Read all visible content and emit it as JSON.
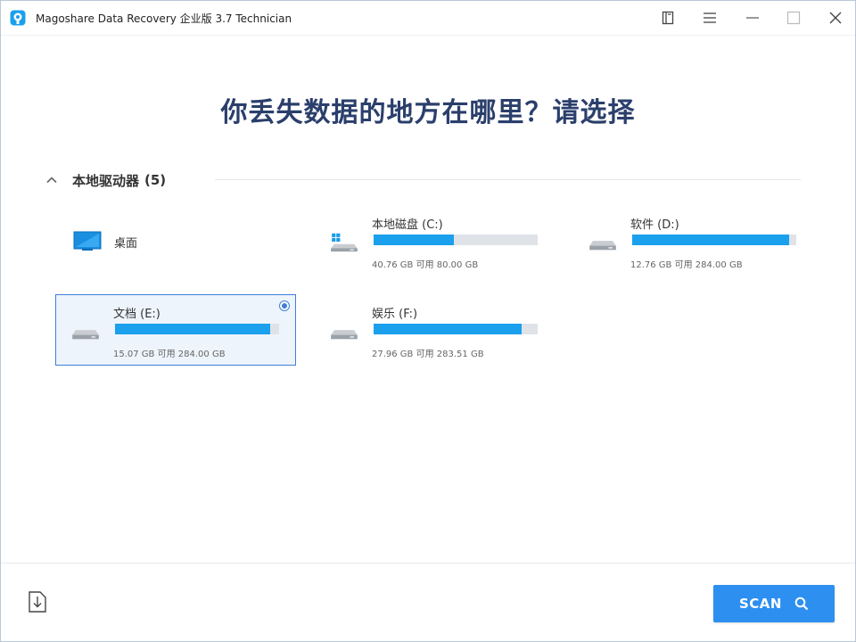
{
  "window": {
    "title": "Magoshare Data Recovery 企业版 3.7 Technician"
  },
  "headline": "你丢失数据的地方在哪里？请选择",
  "section": {
    "title": "本地驱动器",
    "count": "(5)"
  },
  "desktop": {
    "label": "桌面"
  },
  "drives": [
    {
      "name": "本地磁盘 (C:)",
      "size_text": "40.76 GB 可用 80.00 GB",
      "used_fraction": 0.49,
      "os_drive": true,
      "selected": false
    },
    {
      "name": "软件 (D:)",
      "size_text": "12.76 GB 可用 284.00 GB",
      "used_fraction": 0.955,
      "os_drive": false,
      "selected": false
    },
    {
      "name": "文档 (E:)",
      "size_text": "15.07 GB 可用 284.00 GB",
      "used_fraction": 0.947,
      "os_drive": false,
      "selected": true
    },
    {
      "name": "娱乐 (F:)",
      "size_text": "27.96 GB 可用 283.51 GB",
      "used_fraction": 0.901,
      "os_drive": false,
      "selected": false
    }
  ],
  "footer": {
    "scan_label": "SCAN"
  },
  "colors": {
    "accent": "#2d8ff0",
    "bar_fill": "#1aa0ec",
    "bar_track": "#dfe3e8",
    "headline": "#2b3f6c",
    "selected_bg": "#eef4fc",
    "selected_border": "#3f7fd8"
  },
  "icons": {
    "app": "magoshare-logo-icon",
    "titlebar": [
      "bookmark-icon",
      "menu-icon",
      "minimize-icon",
      "maximize-icon",
      "close-icon"
    ],
    "section": "chevron-up-icon",
    "desktop": "monitor-icon",
    "drive": "hard-drive-icon",
    "export": "export-download-icon",
    "scan": "search-icon"
  }
}
